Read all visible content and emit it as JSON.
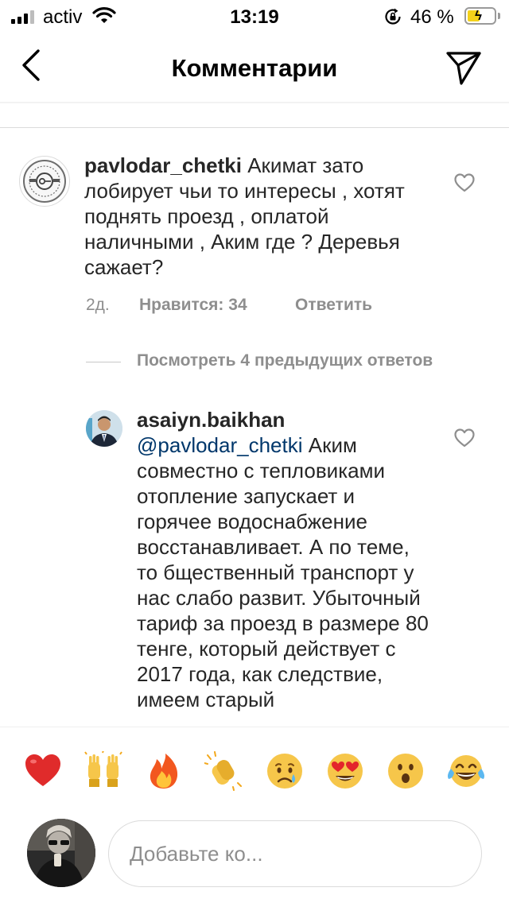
{
  "status_bar": {
    "carrier": "activ",
    "time": "13:19",
    "battery_percent": "46 %",
    "battery_level": 0.46,
    "signal_bars_filled": 3,
    "signal_bars_total": 4
  },
  "header": {
    "title": "Комментарии",
    "back_icon": "chevron-left-icon",
    "send_icon": "paper-plane-icon"
  },
  "comments": [
    {
      "username": "pavlodar_chetki",
      "text": "Акимат зато лобирует чьи то интересы , хотят поднять проезд , оплатой наличными , Аким где ? Деревья сажает?",
      "age": "2д.",
      "likes": "Нравится: 34",
      "reply": "Ответить",
      "liked": false
    }
  ],
  "view_replies": "Посмотреть 4 предыдущих ответов",
  "reply": {
    "username": "asaiyn.baikhan",
    "mention": "@pavlodar_chetki",
    "text": "Аким совместно с тепловиками отопление запускает и горячее водоснабжение восстанавливает.  А по теме, то бщественный транспорт у нас слабо развит. Убыточный тариф за проезд в размере 80 тенге, который действует с 2017 года, как следствие, имеем старый",
    "liked": false
  },
  "emoji_bar": [
    "❤️",
    "🙌",
    "🔥",
    "👏",
    "😢",
    "😍",
    "😮",
    "😂"
  ],
  "composer": {
    "placeholder": "Добавьте ко..."
  },
  "colors": {
    "mention": "#00376b",
    "secondary_text": "#8e8e8e",
    "battery_fill": "#f4d21a"
  }
}
